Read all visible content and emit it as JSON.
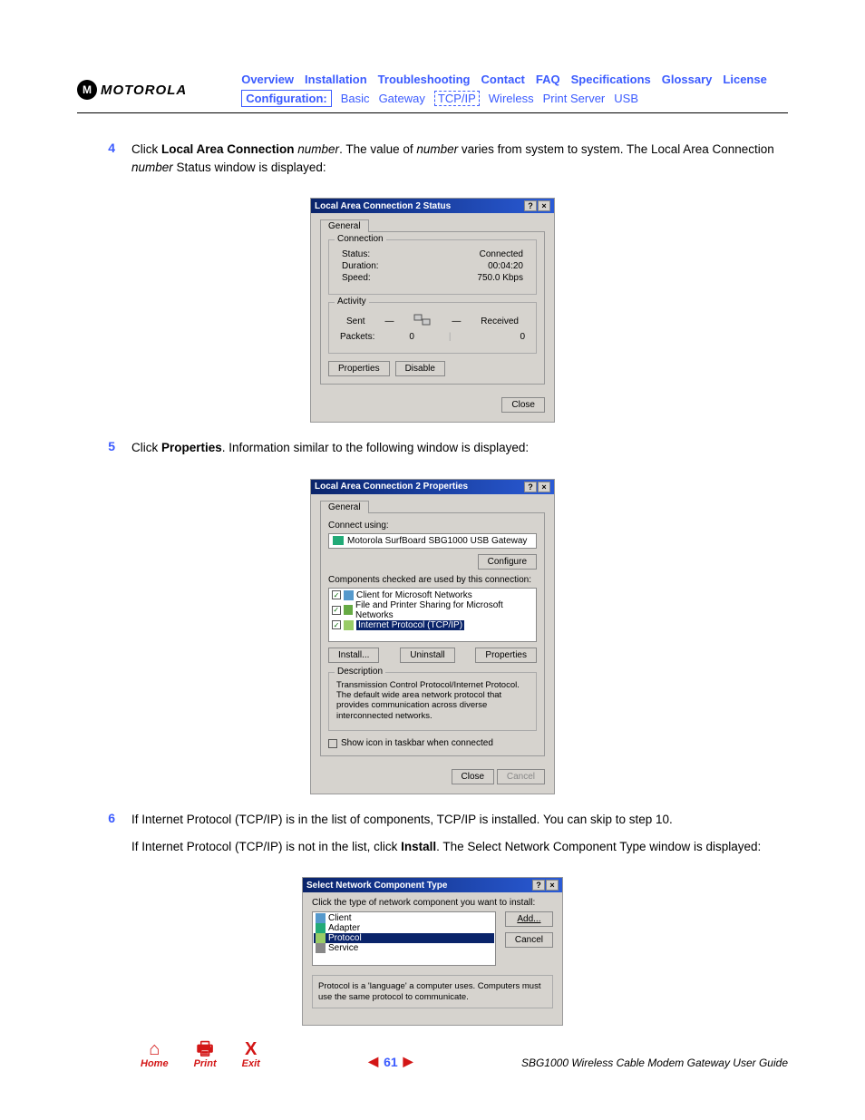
{
  "brand": "MOTOROLA",
  "nav": {
    "row1": [
      "Overview",
      "Installation",
      "Troubleshooting",
      "Contact",
      "FAQ",
      "Specifications",
      "Glossary",
      "License"
    ],
    "config_label": "Configuration:",
    "row2": [
      "Basic",
      "Gateway",
      "TCP/IP",
      "Wireless",
      "Print Server",
      "USB"
    ]
  },
  "steps": {
    "s4": {
      "num": "4",
      "pre": "Click ",
      "bold": "Local Area Connection",
      "ital1": " number",
      "mid": ". The value of ",
      "ital2": "number",
      "mid2": " varies from system to system. The Local Area Connection ",
      "ital3": "number",
      "post": " Status window is displayed:"
    },
    "s5": {
      "num": "5",
      "pre": "Click ",
      "bold": "Properties",
      "post": ". Information similar to the following window is displayed:"
    },
    "s6": {
      "num": "6",
      "line1": "If Internet Protocol (TCP/IP) is in the list of components, TCP/IP is installed. You can skip to step 10.",
      "line2a": "If Internet Protocol (TCP/IP) is not in the list, click ",
      "line2bold": "Install",
      "line2b": ". The Select Network Component Type window is displayed:"
    }
  },
  "dlg1": {
    "title": "Local Area Connection 2 Status",
    "tab": "General",
    "grp_conn": "Connection",
    "status_l": "Status:",
    "status_v": "Connected",
    "dur_l": "Duration:",
    "dur_v": "00:04:20",
    "speed_l": "Speed:",
    "speed_v": "750.0 Kbps",
    "grp_act": "Activity",
    "sent": "Sent",
    "recv": "Received",
    "pkts_l": "Packets:",
    "pkts_sent": "0",
    "pkts_recv": "0",
    "btn_props": "Properties",
    "btn_disable": "Disable",
    "btn_close": "Close"
  },
  "dlg2": {
    "title": "Local Area Connection 2 Properties",
    "tab": "General",
    "connect_using": "Connect using:",
    "adapter": "Motorola SurfBoard SBG1000 USB Gateway",
    "btn_configure": "Configure",
    "comp_label": "Components checked are used by this connection:",
    "items": [
      "Client for Microsoft Networks",
      "File and Printer Sharing for Microsoft Networks",
      "Internet Protocol (TCP/IP)"
    ],
    "btn_install": "Install...",
    "btn_uninstall": "Uninstall",
    "btn_props": "Properties",
    "desc_title": "Description",
    "desc": "Transmission Control Protocol/Internet Protocol. The default wide area network protocol that provides communication across diverse interconnected networks.",
    "show_icon": "Show icon in taskbar when connected",
    "btn_close": "Close",
    "btn_cancel": "Cancel"
  },
  "dlg3": {
    "title": "Select Network Component Type",
    "prompt": "Click the type of network component you want to install:",
    "items": [
      "Client",
      "Adapter",
      "Protocol",
      "Service"
    ],
    "desc": "Protocol is a 'language' a computer uses. Computers must use the same protocol to communicate.",
    "btn_add": "Add...",
    "btn_cancel": "Cancel"
  },
  "footer": {
    "home": "Home",
    "print": "Print",
    "exit": "Exit",
    "page": "61",
    "guide": "SBG1000 Wireless Cable Modem Gateway User Guide"
  }
}
